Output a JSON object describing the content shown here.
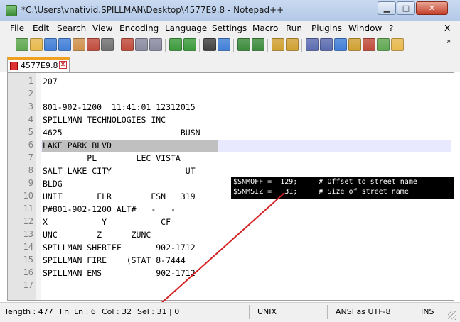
{
  "window": {
    "title": "*C:\\Users\\vnativid.SPILLMAN\\Desktop\\4577E9.8 - Notepad++",
    "min_label": "▁",
    "max_label": "□",
    "close_label": "✕"
  },
  "menu": {
    "items": [
      "File",
      "Edit",
      "Search",
      "View",
      "Encoding",
      "Language",
      "Settings",
      "Macro",
      "Run",
      "Plugins",
      "Window",
      "?"
    ],
    "close_label": "X"
  },
  "toolbar": {
    "more_label": "»",
    "colors": [
      "#5fa84f",
      "#e8b84a",
      "#3f7ed8",
      "#3f7ed8",
      "#d0904a",
      "#c04a3a",
      "#707070",
      "#c04a3a",
      "#8a8aa0",
      "#8a8aa0",
      "#3a9a3a",
      "#3a9a3a",
      "#404040",
      "#3f7ed8",
      "#3a8a3a",
      "#3a8a3a",
      "#d0a030",
      "#d0a030",
      "#5a6ab0",
      "#5a6ab0",
      "#3f7ed8",
      "#d0a030",
      "#c04a3a"
    ]
  },
  "tab": {
    "label": "4577E9.8",
    "close_label": "x"
  },
  "editor": {
    "lines": [
      {
        "n": "1",
        "text": "207"
      },
      {
        "n": "2",
        "text": ""
      },
      {
        "n": "3",
        "text": "801-902-1200  11:41:01 12312015"
      },
      {
        "n": "4",
        "text": "SPILLMAN TECHNOLOGIES INC"
      },
      {
        "n": "5",
        "text": "4625                        BUSN"
      },
      {
        "n": "6",
        "text": "LAKE PARK BLVD"
      },
      {
        "n": "7",
        "text": "         PL        LEC VISTA"
      },
      {
        "n": "8",
        "text": "SALT LAKE CITY               UT"
      },
      {
        "n": "9",
        "text": "BLDG"
      },
      {
        "n": "10",
        "text": "UNIT       FLR        ESN   319"
      },
      {
        "n": "11",
        "text": "P#801-902-1200 ALT#   -   -"
      },
      {
        "n": "12",
        "text": "X           Y           CF"
      },
      {
        "n": "13",
        "text": "UNC        Z      ZUNC"
      },
      {
        "n": "14",
        "text": "SPILLMAN SHERIFF       902-1712"
      },
      {
        "n": "15",
        "text": "SPILLMAN FIRE    (STAT 8-7444"
      },
      {
        "n": "16",
        "text": "SPILLMAN EMS           902-1712"
      },
      {
        "n": "17",
        "text": ""
      }
    ]
  },
  "annotation": {
    "line1": "$SNMOFF =  129;     # Offset to street name",
    "line2": "$SNMSIZ =   31;     # Size of street name",
    "arrow_color": "#d42020"
  },
  "status": {
    "length": "length : 477",
    "lines": "lin",
    "ln": "Ln : 6",
    "col": "Col : 32",
    "sel": "Sel : 31 | 0",
    "eol": "UNIX",
    "encoding": "ANSI as UTF-8",
    "mode": "INS"
  }
}
